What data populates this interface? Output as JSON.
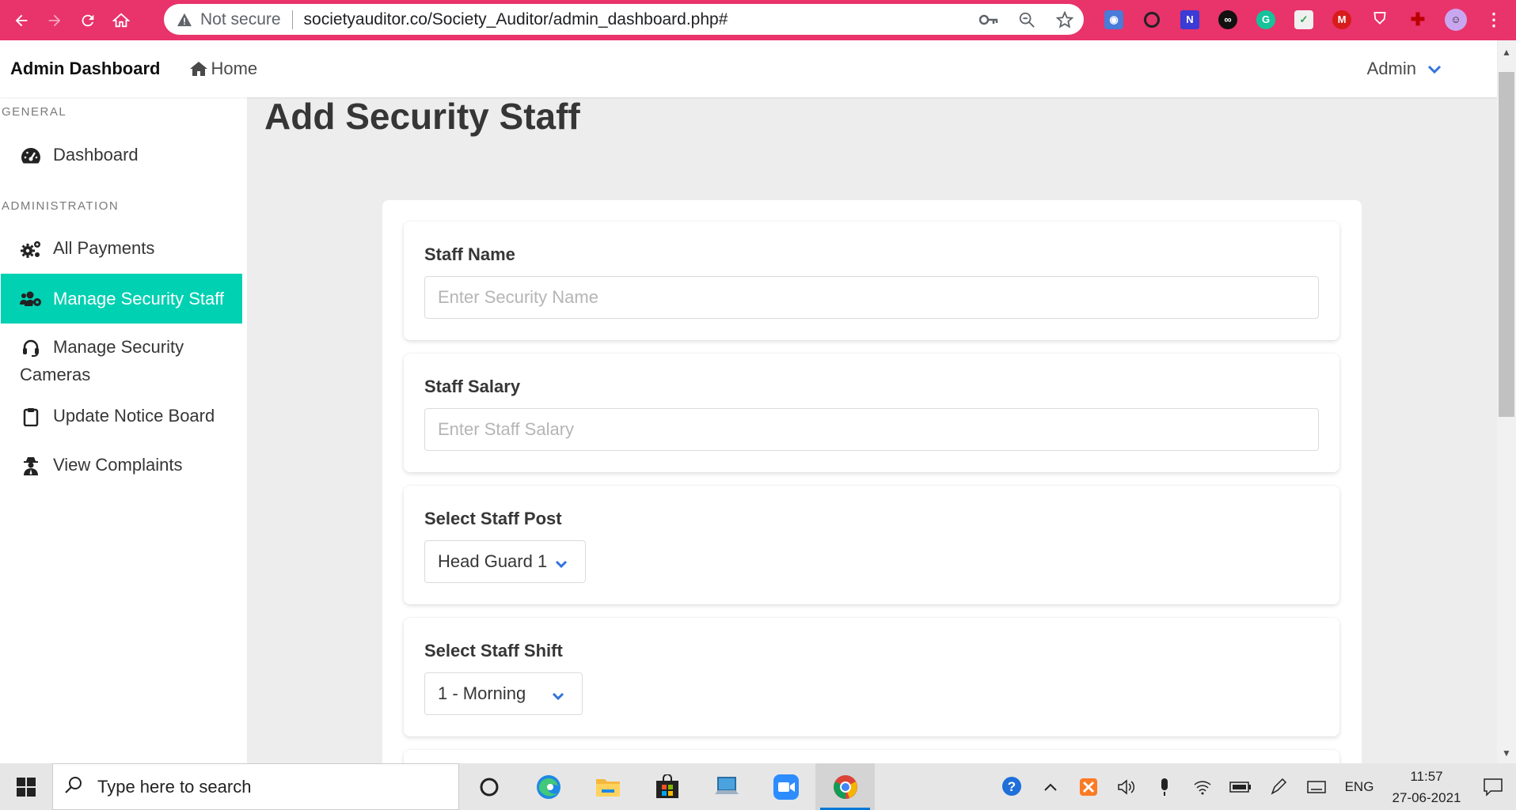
{
  "browser": {
    "security_label": "Not secure",
    "url": "societyauditor.co/Society_Auditor/admin_dashboard.php#",
    "theme_color": "#e8336b"
  },
  "navbar": {
    "brand": "Admin Dashboard",
    "home_label": "Home",
    "user_label": "Admin"
  },
  "sidebar": {
    "section_general": "GENERAL",
    "section_admin": "ADMINISTRATION",
    "items": [
      {
        "label": "Dashboard",
        "icon": "tachometer-icon"
      },
      {
        "label": "All Payments",
        "icon": "cogs-icon"
      },
      {
        "label": "Manage Security Staff",
        "icon": "users-cog-icon",
        "active": true
      },
      {
        "label": "Manage Security Cameras",
        "icon": "headset-icon"
      },
      {
        "label": "Update Notice Board",
        "icon": "clipboard-icon"
      },
      {
        "label": "View Complaints",
        "icon": "user-secret-icon"
      }
    ],
    "active_color": "#00d1b2"
  },
  "main": {
    "title": "Add Security Staff",
    "fields": {
      "name": {
        "label": "Staff Name",
        "placeholder": "Enter Security Name",
        "value": ""
      },
      "salary": {
        "label": "Staff Salary",
        "placeholder": "Enter Staff Salary",
        "value": ""
      },
      "post": {
        "label": "Select Staff Post",
        "selected": "Head Guard 1"
      },
      "shift": {
        "label": "Select Staff Shift",
        "selected": "1 - Morning"
      }
    }
  },
  "taskbar": {
    "search_placeholder": "Type here to search",
    "language": "ENG",
    "time": "11:57",
    "date": "27-06-2021"
  }
}
